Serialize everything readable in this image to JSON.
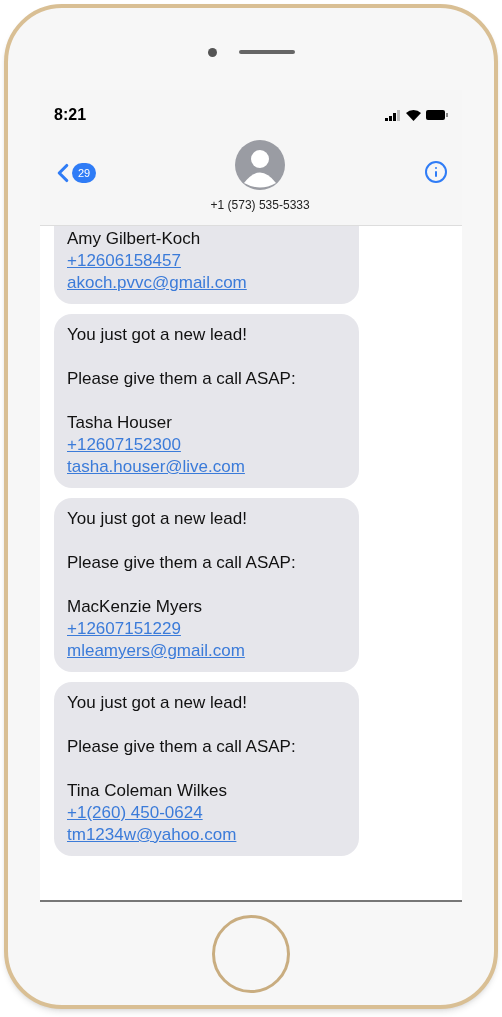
{
  "status_bar": {
    "time": "8:21"
  },
  "nav_bar": {
    "back_badge": "29",
    "contact": "+1 (573) 535-5333"
  },
  "messages": [
    {
      "name": "Amy Gilbert-Koch",
      "phone": "+12606158457",
      "email": "akoch.pvvc@gmail.com"
    },
    {
      "greeting": "You just got a new lead!",
      "request": "Please give them a call ASAP:",
      "name": "Tasha Houser",
      "phone": "+12607152300",
      "email": "tasha.houser@live.com"
    },
    {
      "greeting": "You just got a new lead!",
      "request": "Please give them a call ASAP:",
      "name": "MacKenzie Myers",
      "phone": "+12607151229",
      "email": "mleamyers@gmail.com"
    },
    {
      "greeting": "You just got a new lead!",
      "request": "Please give them a call ASAP:",
      "name": "Tina Coleman Wilkes",
      "phone": "+1(260) 450-0624",
      "email": "tm1234w@yahoo.com"
    }
  ]
}
